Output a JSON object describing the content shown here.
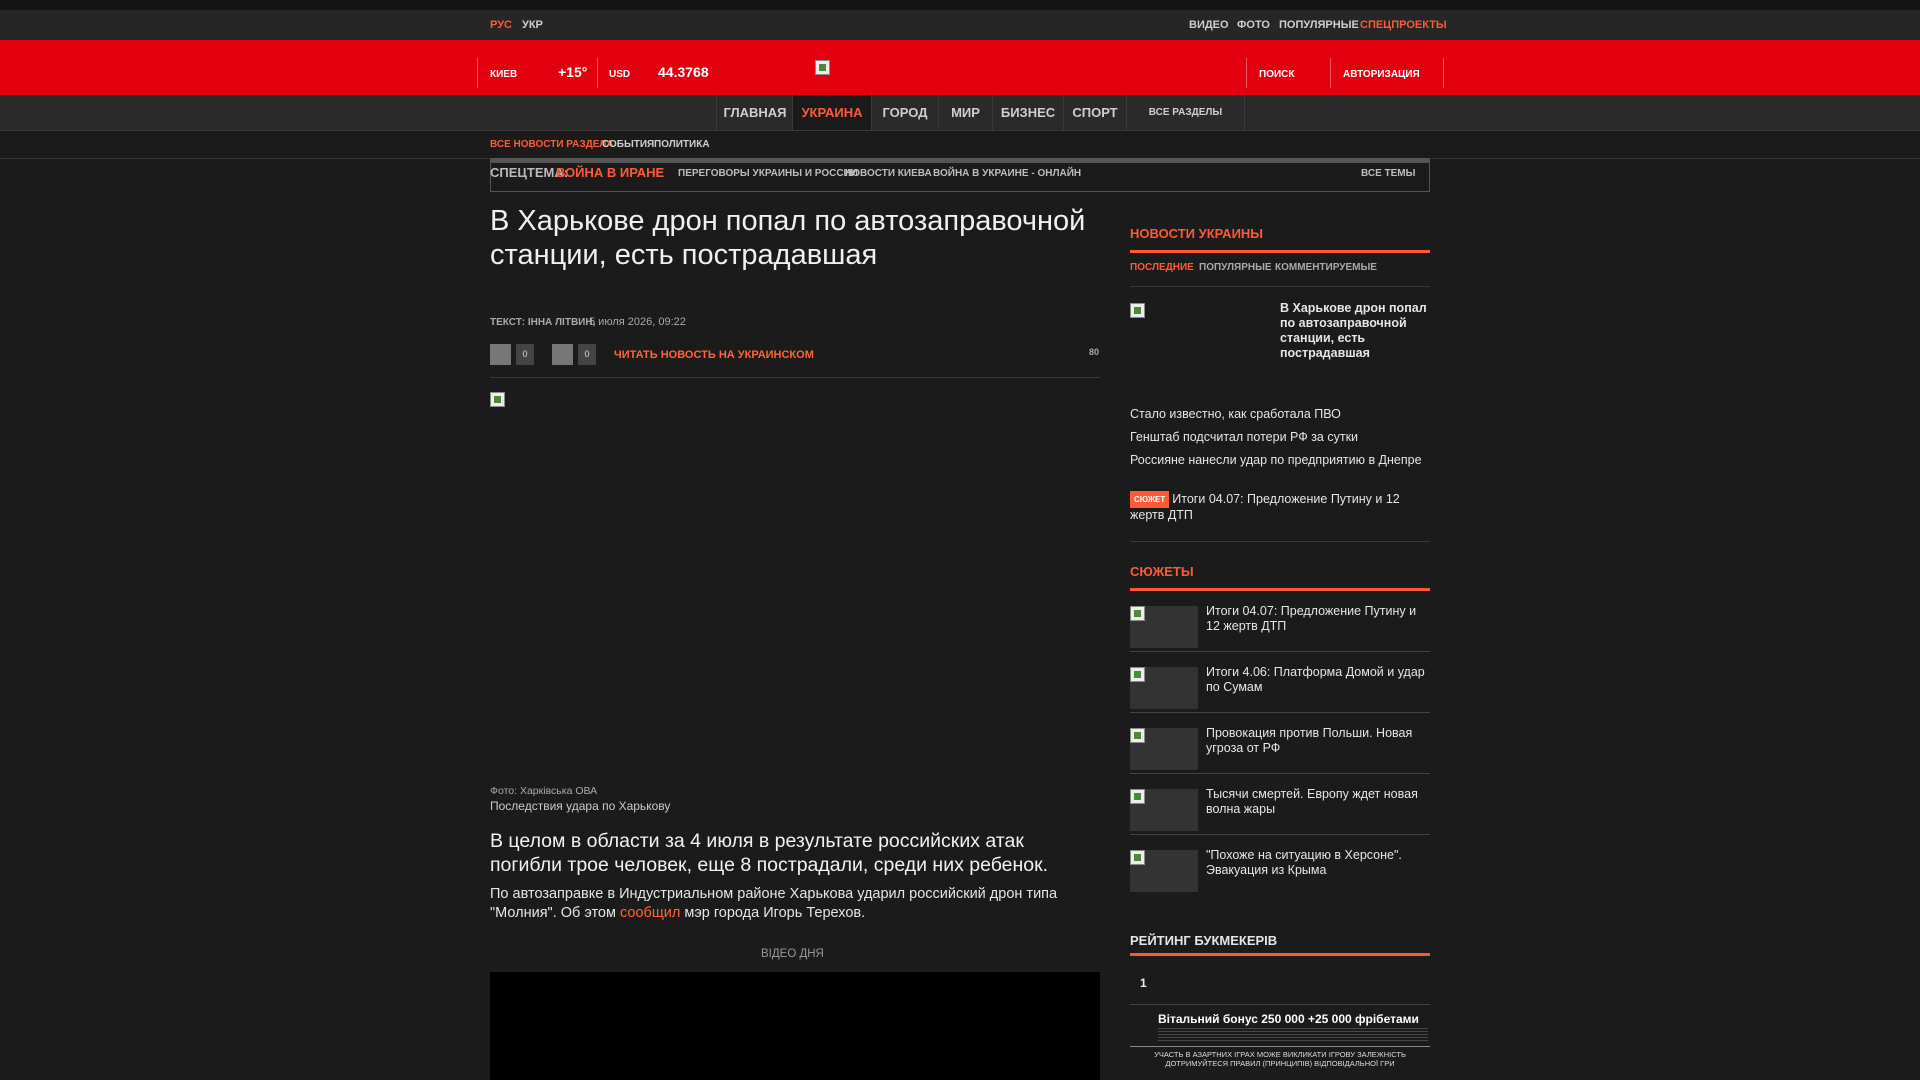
{
  "lang": {
    "ru": "РУС",
    "ua": "УКР"
  },
  "toplinks": [
    "ВИДЕО",
    "ФОТО",
    "ПОПУЛЯРНЫЕ",
    "СПЕЦПРОЕКТЫ"
  ],
  "header": {
    "city": "КИЕВ",
    "temp": "+15°",
    "currency": "USD",
    "rate": "44.3768",
    "search": "ПОИСК",
    "auth": "АВТОРИЗАЦИЯ"
  },
  "nav": [
    {
      "label": "ГЛАВНАЯ"
    },
    {
      "label": "УКРАИНА"
    },
    {
      "label": "ГОРОД"
    },
    {
      "label": "МИР"
    },
    {
      "label": "БИЗНЕС"
    },
    {
      "label": "СПОРТ"
    },
    {
      "label": "ВСЕ РАЗДЕЛЫ"
    }
  ],
  "subnav": [
    "ВСЕ НОВОСТИ РАЗДЕЛА",
    "СОБЫТИЯ",
    "ПОЛИТИКА"
  ],
  "spec": {
    "label": "СПЕЦТЕМА:",
    "topic": "ВОЙНА В ИРАНЕ",
    "links": [
      "ПЕРЕГОВОРЫ УКРАИНЫ И РОССИИ",
      "НОВОСТИ КИЕВА",
      "ВОЙНА В УКРАИНЕ - ОНЛАЙН"
    ],
    "all": "ВСЕ ТЕМЫ"
  },
  "article": {
    "title": "В Харькове дрон попал по автозаправочной станции, есть пострадавшая",
    "author_label": "ТЕКСТ:",
    "author": "ІННА ЛІТВИН",
    "date": "5 июля 2026, 09:22",
    "likes": "0",
    "comments": "0",
    "read_ua": "ЧИТАТЬ НОВОСТЬ НА УКРАИНСКОМ",
    "views": "80",
    "photo_credit": "Фото: Харківська ОВА",
    "photo_caption": "Последствия удара по Харькову",
    "lead": "В целом в области за 4 июля в результате российских атак погибли трое человек, еще 8 пострадали, среди них ребенок.",
    "para_1": "По автозаправке в Индустриальном районе Харькова ударил российский дрон типа \"Молния\". Об этом ",
    "para_link": "сообщил",
    "para_2": " мэр города Игорь Терехов.",
    "video_label": "ВІДЕО ДНЯ"
  },
  "sidebar": {
    "news_title": "НОВОСТИ УКРАИНЫ",
    "tabs": [
      "ПОСЛЕДНИЕ",
      "ПОПУЛЯРНЫЕ",
      "КОММЕНТИРУЕМЫЕ"
    ],
    "top_news": "В Харькове дрон попал по автозаправочной станции, есть пострадавшая",
    "news": [
      "Стало известно, как сработала ПВО",
      "Генштаб подсчитал потери РФ за сутки",
      "Россияне нанесли удар по предприятию в Днепре"
    ],
    "badge_news": {
      "badge": "СЮЖЕТ",
      "text": "Итоги 04.07: Предложение Путину и 12 жертв ДТП"
    },
    "stories_title": "СЮЖЕТЫ",
    "stories": [
      "Итоги 04.07: Предложение Путину и 12 жертв ДТП",
      "Итоги 4.06: Платформа Домой и удар по Сумам",
      "Провокация против Польши. Новая угроза от РФ",
      "Тысячи смертей. Европу ждет новая волна жары",
      "\"Похоже на ситуацию в Херсоне\". Эвакуация из Крыма"
    ],
    "rating_title": "РЕЙТИНГ БУКМЕКЕРІВ",
    "rating_num": "1",
    "bonus": "Вітальний бонус 250 000 +25 000 фрібетами",
    "warning": "УЧАСТЬ В АЗАРТНИХ ІГРАХ МОЖЕ ВИКЛИКАТИ ІГРОВУ ЗАЛЕЖНІСТЬ ДОТРИМУЙТЕСЯ ПРАВИЛ (ПРИНЦИПІВ) ВІДПОВІДАЛЬНОЇ ГРИ"
  },
  "colors": {
    "accent": "#ff5a36",
    "header_red": "#e3000f",
    "bg": "#1b1b1b"
  }
}
